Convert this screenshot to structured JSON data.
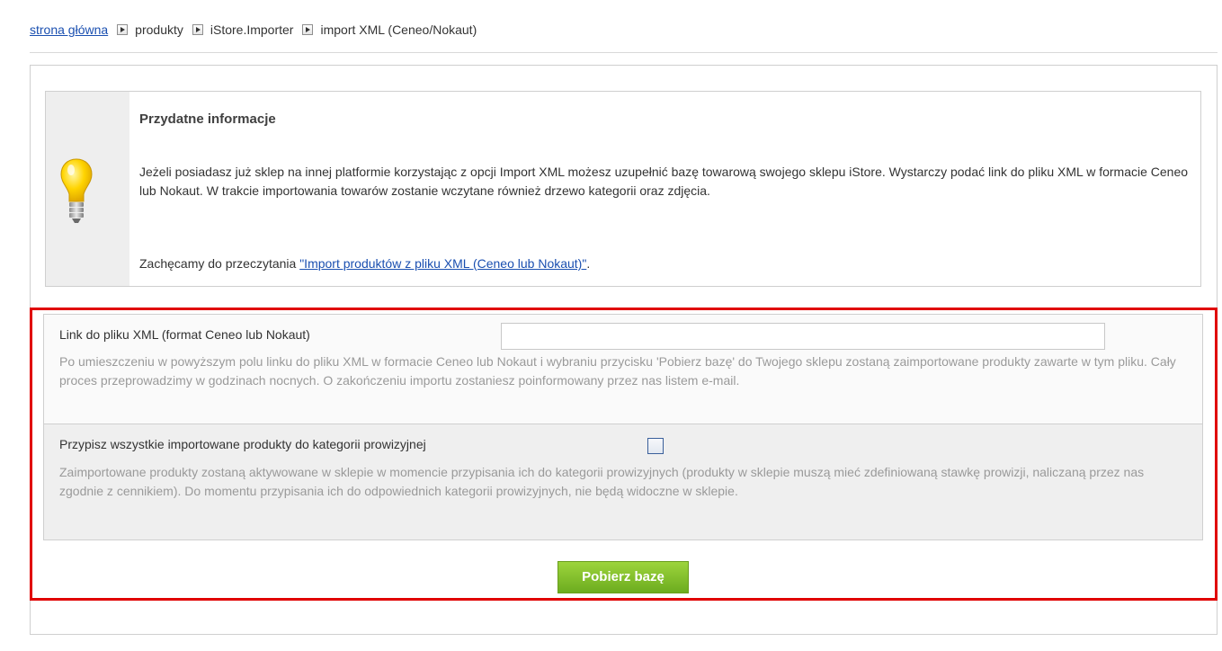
{
  "breadcrumb": {
    "home": "strona główna",
    "items": [
      "produkty",
      "iStore.Importer",
      "import XML (Ceneo/Nokaut)"
    ]
  },
  "info": {
    "title": "Przydatne informacje",
    "text": "Jeżeli posiadasz już sklep na innej platformie korzystając z opcji Import XML możesz uzupełnić bazę towarową swojego sklepu iStore. Wystarczy podać link do pliku XML w formacie Ceneo lub Nokaut. W trakcie importowania towarów zostanie wczytane również drzewo kategorii oraz zdjęcia.",
    "read_prefix": "Zachęcamy do przeczytania ",
    "read_link": "\"Import produktów z pliku XML (Ceneo lub Nokaut)\"",
    "read_suffix": "."
  },
  "form": {
    "xml_link": {
      "label": "Link do pliku XML (format Ceneo lub Nokaut)",
      "value": "",
      "help": "Po umieszczeniu w powyższym polu linku do pliku XML w formacie Ceneo lub Nokaut i wybraniu przycisku 'Pobierz bazę' do Twojego sklepu zostaną zaimportowane produkty zawarte w tym pliku. Cały proces przeprowadzimy w godzinach nocnych. O zakończeniu importu zostaniesz poinformowany przez nas listem e-mail."
    },
    "commission": {
      "label": "Przypisz wszystkie importowane produkty do kategorii prowizyjnej",
      "checked": false,
      "help": "Zaimportowane produkty zostaną aktywowane w sklepie w momencie przypisania ich do kategorii prowizyjnych (produkty w sklepie muszą mieć zdefiniowaną stawkę prowizji, naliczaną przez nas zgodnie z cennikiem). Do momentu przypisania ich do odpowiednich kategorii prowizyjnych, nie będą widoczne w sklepie."
    },
    "submit_label": "Pobierz bazę"
  },
  "colors": {
    "link": "#1a4fb0",
    "highlight": "#e00000",
    "button": "#7fbf26"
  }
}
